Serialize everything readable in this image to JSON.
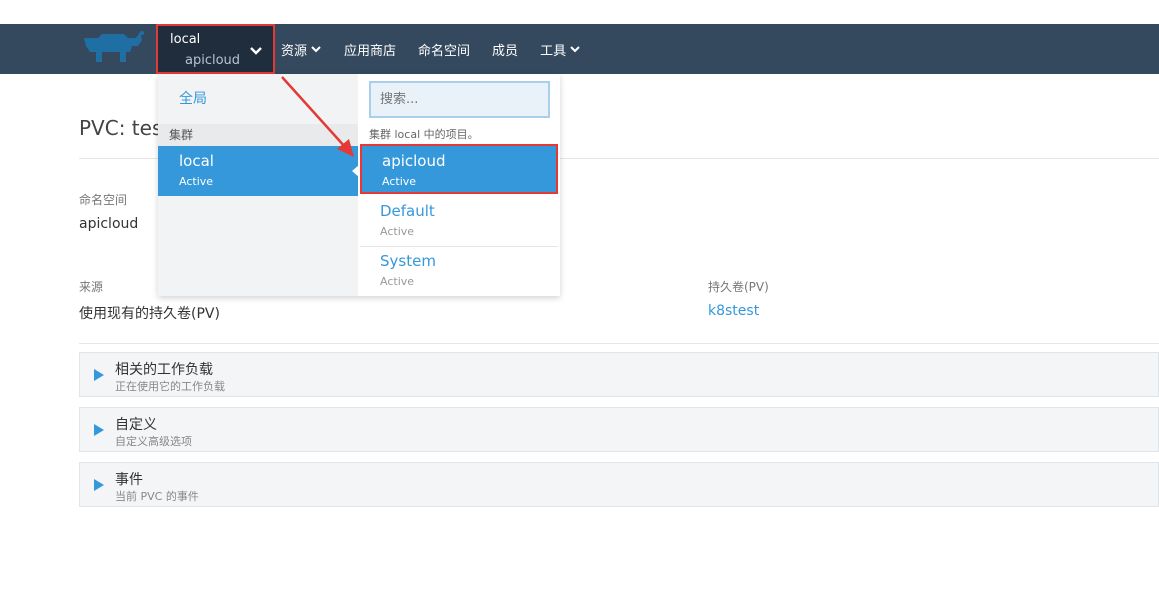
{
  "header": {
    "cluster": "local",
    "project": "apicloud",
    "nav": [
      {
        "label": "资源",
        "has_caret": true
      },
      {
        "label": "应用商店",
        "has_caret": false
      },
      {
        "label": "命名空间",
        "has_caret": false
      },
      {
        "label": "成员",
        "has_caret": false
      },
      {
        "label": "工具",
        "has_caret": true
      }
    ]
  },
  "page": {
    "title": "PVC: tes",
    "namespace_label": "命名空间",
    "namespace_value": "apicloud",
    "source_label": "来源",
    "source_value": "使用现有的持久卷(PV)",
    "pv_label": "持久卷(PV)",
    "pv_value": "k8stest"
  },
  "sections": [
    {
      "title": "相关的工作负载",
      "subtitle": "正在使用它的工作负载"
    },
    {
      "title": "自定义",
      "subtitle": "自定义高级选项"
    },
    {
      "title": "事件",
      "subtitle": "当前 PVC 的事件"
    }
  ],
  "dropdown": {
    "global_label": "全局",
    "clusters_header": "集群",
    "cluster": {
      "name": "local",
      "status": "Active"
    },
    "search_placeholder": "搜索...",
    "hint": "集群 local 中的项目。",
    "projects": [
      {
        "name": "apicloud",
        "status": "Active"
      },
      {
        "name": "Default",
        "status": "Active"
      },
      {
        "name": "System",
        "status": "Active"
      }
    ]
  },
  "colors": {
    "topbar": "#34495e",
    "accent": "#3498db",
    "highlight": "#e53935"
  }
}
